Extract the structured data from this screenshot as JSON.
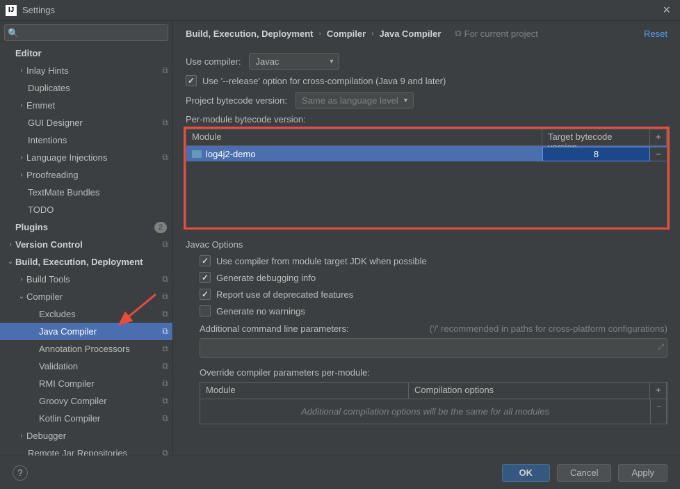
{
  "window": {
    "title": "Settings"
  },
  "search": {
    "placeholder": ""
  },
  "tree": {
    "editor": "Editor",
    "inlay": "Inlay Hints",
    "duplicates": "Duplicates",
    "emmet": "Emmet",
    "gui": "GUI Designer",
    "intentions": "Intentions",
    "lang_inj": "Language Injections",
    "proofreading": "Proofreading",
    "textmate": "TextMate Bundles",
    "todo": "TODO",
    "plugins": "Plugins",
    "plugins_count": "2",
    "version_control": "Version Control",
    "bed": "Build, Execution, Deployment",
    "build_tools": "Build Tools",
    "compiler": "Compiler",
    "excludes": "Excludes",
    "java_compiler": "Java Compiler",
    "annotation": "Annotation Processors",
    "validation": "Validation",
    "rmi": "RMI Compiler",
    "groovy": "Groovy Compiler",
    "kotlin": "Kotlin Compiler",
    "debugger": "Debugger",
    "remote_jar": "Remote Jar Repositories"
  },
  "breadcrumb": {
    "p1": "Build, Execution, Deployment",
    "p2": "Compiler",
    "p3": "Java Compiler"
  },
  "project_badge": "For current project",
  "reset": "Reset",
  "use_compiler_label": "Use compiler:",
  "use_compiler_value": "Javac",
  "release_option": "Use '--release' option for cross-compilation (Java 9 and later)",
  "project_bytecode_label": "Project bytecode version:",
  "project_bytecode_value": "Same as language level",
  "per_module_label": "Per-module bytecode version:",
  "module_table": {
    "th_module": "Module",
    "th_version": "Target bytecode version",
    "row_module": "log4j2-demo",
    "row_version": "8"
  },
  "javac_title": "Javac Options",
  "javac": {
    "use_target_jdk": "Use compiler from module target JDK when possible",
    "gen_debug": "Generate debugging info",
    "report_deprecated": "Report use of deprecated features",
    "no_warnings": "Generate no warnings",
    "add_params_label": "Additional command line parameters:",
    "add_params_hint": "('/' recommended in paths for cross-platform configurations)",
    "override_label": "Override compiler parameters per-module:",
    "override_th_module": "Module",
    "override_th_opts": "Compilation options",
    "override_empty": "Additional compilation options will be the same for all modules"
  },
  "footer": {
    "ok": "OK",
    "cancel": "Cancel",
    "apply": "Apply"
  }
}
